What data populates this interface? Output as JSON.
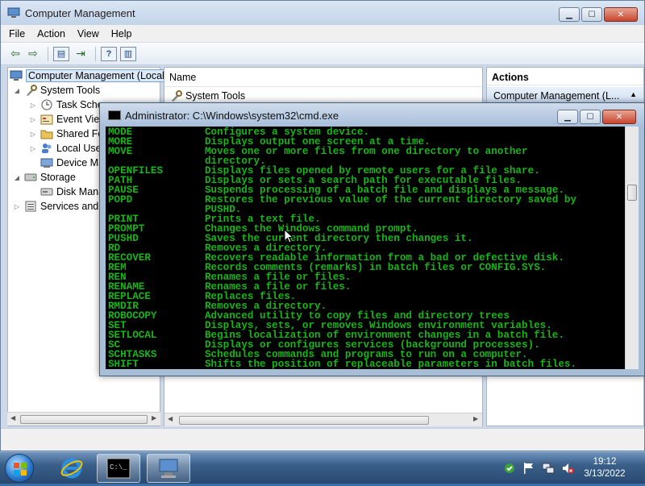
{
  "cm_window": {
    "title": "Computer Management",
    "menu": [
      "File",
      "Action",
      "View",
      "Help"
    ],
    "tree": [
      {
        "label": "Computer Management (Local",
        "level": 0,
        "icon": "computer-management-icon"
      },
      {
        "label": "System Tools",
        "level": 1,
        "icon": "system-tools-icon"
      },
      {
        "label": "Task Sche",
        "level": 2,
        "icon": "task-scheduler-icon"
      },
      {
        "label": "Event View",
        "level": 2,
        "icon": "event-viewer-icon"
      },
      {
        "label": "Shared Fo",
        "level": 2,
        "icon": "shared-folders-icon"
      },
      {
        "label": "Local Use",
        "level": 2,
        "icon": "local-users-icon"
      },
      {
        "label": "Device Ma",
        "level": 2,
        "icon": "device-manager-icon"
      },
      {
        "label": "Storage",
        "level": 1,
        "icon": "storage-icon"
      },
      {
        "label": "Disk Mana",
        "level": 2,
        "icon": "disk-management-icon"
      },
      {
        "label": "Services and A",
        "level": 1,
        "icon": "services-icon"
      }
    ],
    "main": {
      "column_header": "Name",
      "rows": [
        "System Tools"
      ]
    },
    "actions": {
      "header": "Actions",
      "subheader": "Computer Management (L..."
    }
  },
  "cmd_window": {
    "title": "Administrator: C:\\Windows\\system32\\cmd.exe",
    "text_color": "#18b418",
    "lines": [
      {
        "cmd": "MODE",
        "desc": "Configures a system device."
      },
      {
        "cmd": "MORE",
        "desc": "Displays output one screen at a time."
      },
      {
        "cmd": "MOVE",
        "desc": "Moves one or more files from one directory to another"
      },
      {
        "cmd": "",
        "desc": "directory."
      },
      {
        "cmd": "OPENFILES",
        "desc": "Displays files opened by remote users for a file share."
      },
      {
        "cmd": "PATH",
        "desc": "Displays or sets a search path for executable files."
      },
      {
        "cmd": "PAUSE",
        "desc": "Suspends processing of a batch file and displays a message."
      },
      {
        "cmd": "POPD",
        "desc": "Restores the previous value of the current directory saved by"
      },
      {
        "cmd": "",
        "desc": "PUSHD."
      },
      {
        "cmd": "PRINT",
        "desc": "Prints a text file."
      },
      {
        "cmd": "PROMPT",
        "desc": "Changes the Windows command prompt."
      },
      {
        "cmd": "PUSHD",
        "desc": "Saves the current directory then changes it."
      },
      {
        "cmd": "RD",
        "desc": "Removes a directory."
      },
      {
        "cmd": "RECOVER",
        "desc": "Recovers readable information from a bad or defective disk."
      },
      {
        "cmd": "REM",
        "desc": "Records comments (remarks) in batch files or CONFIG.SYS."
      },
      {
        "cmd": "REN",
        "desc": "Renames a file or files."
      },
      {
        "cmd": "RENAME",
        "desc": "Renames a file or files."
      },
      {
        "cmd": "REPLACE",
        "desc": "Replaces files."
      },
      {
        "cmd": "RMDIR",
        "desc": "Removes a directory."
      },
      {
        "cmd": "ROBOCOPY",
        "desc": "Advanced utility to copy files and directory trees"
      },
      {
        "cmd": "SET",
        "desc": "Displays, sets, or removes Windows environment variables."
      },
      {
        "cmd": "SETLOCAL",
        "desc": "Begins localization of environment changes in a batch file."
      },
      {
        "cmd": "SC",
        "desc": "Displays or configures services (background processes)."
      },
      {
        "cmd": "SCHTASKS",
        "desc": "Schedules commands and programs to run on a computer."
      },
      {
        "cmd": "SHIFT",
        "desc": "Shifts the position of replaceable parameters in batch files."
      }
    ]
  },
  "taskbar": {
    "time": "19:12",
    "date": "3/13/2022",
    "pinned": [
      "internet-explorer-icon",
      "cmd-icon",
      "computer-management-icon"
    ]
  }
}
